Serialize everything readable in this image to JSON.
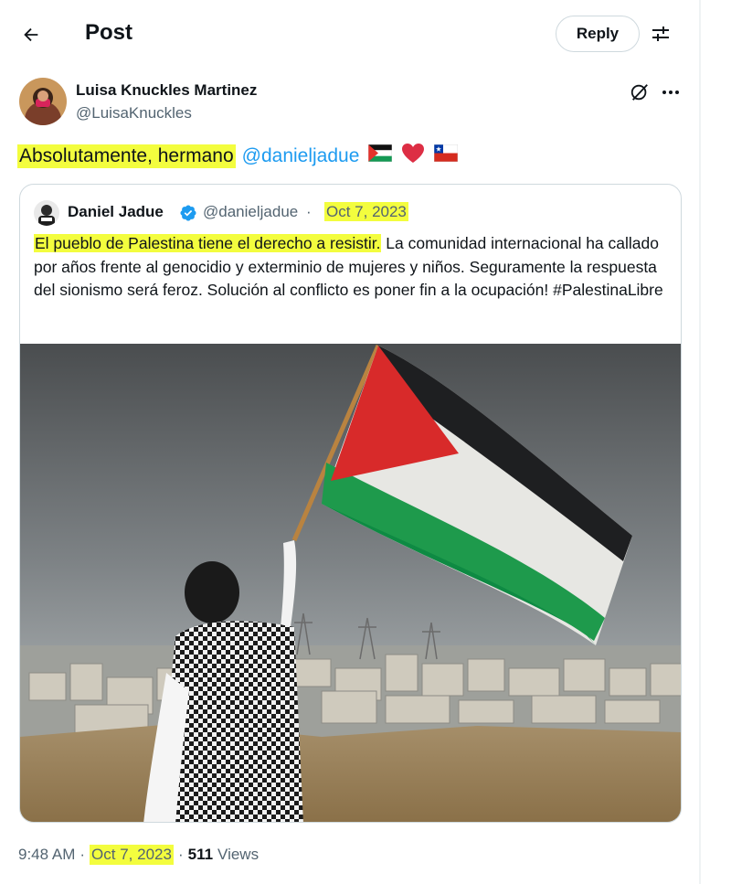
{
  "header": {
    "title": "Post",
    "reply_label": "Reply"
  },
  "author": {
    "name": "Luisa Knuckles Martinez",
    "handle": "@LuisaKnuckles"
  },
  "post": {
    "text_highlighted": "Absolutamente, hermano",
    "mention": "@danieljadue",
    "emojis": [
      "palestine-flag",
      "red-heart",
      "chile-flag"
    ]
  },
  "quote": {
    "name": "Daniel Jadue",
    "handle": "@danieljadue",
    "separator": "·",
    "date": "Oct 7, 2023",
    "text_highlighted": "El pueblo de Palestina tiene el derecho a resistir.",
    "text_rest": " La comunidad internacional ha callado por años frente al genocidio y exterminio de mujeres y niños. Seguramente la respuesta del sionismo será feroz. Solución al conflicto es poner fin a la ocupación! #PalestinaLibre"
  },
  "meta": {
    "time": "9:48 AM",
    "separator": "·",
    "date": "Oct 7, 2023",
    "views_count": "511",
    "views_label": "Views"
  },
  "colors": {
    "link": "#1d9bf0",
    "highlight": "#f3fd3e",
    "muted": "#536471",
    "verified": "#1d9bf0"
  }
}
